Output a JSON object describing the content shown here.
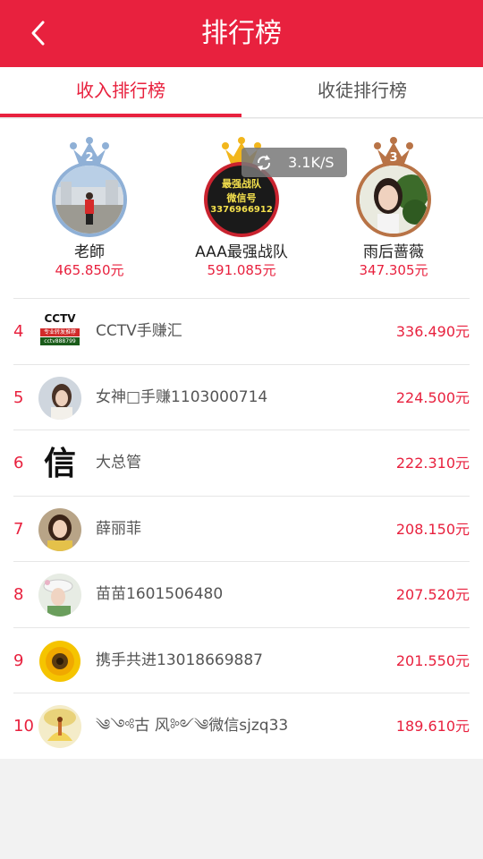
{
  "header": {
    "title": "排行榜",
    "back_icon": "chevron-left-icon"
  },
  "tabs": [
    {
      "label": "收入排行榜",
      "active": true
    },
    {
      "label": "收徒排行榜",
      "active": false
    }
  ],
  "speed_badge": {
    "icon": "refresh-icon",
    "text": "3.1K/S"
  },
  "podium": [
    {
      "rank": "2",
      "name": "老師",
      "amount": "465.850元",
      "crown_color": "#8fb0d6"
    },
    {
      "rank": "1",
      "name": "AAA最强战队",
      "amount": "591.085元",
      "crown_color": "#f2b61c",
      "avatar_text": [
        "最强战队",
        "微信号",
        "3376966912"
      ]
    },
    {
      "rank": "3",
      "name": "雨后蔷薇",
      "amount": "347.305元",
      "crown_color": "#b87346"
    }
  ],
  "ranking": [
    {
      "rank": "4",
      "name": "CCTV手赚汇",
      "amount": "336.490元",
      "avatar_text": [
        "CCTV",
        "专业转发推荐",
        "cctv888799"
      ]
    },
    {
      "rank": "5",
      "name": "女神□手赚1103000714",
      "amount": "224.500元"
    },
    {
      "rank": "6",
      "name": "大总管",
      "amount": "222.310元",
      "avatar_text": [
        "信"
      ]
    },
    {
      "rank": "7",
      "name": "薛丽菲",
      "amount": "208.150元"
    },
    {
      "rank": "8",
      "name": "苗苗1601506480",
      "amount": "207.520元"
    },
    {
      "rank": "9",
      "name": "携手共进13018669887",
      "amount": "201.550元"
    },
    {
      "rank": "10",
      "name": "༄༺古 风༻༄微信sjzq33",
      "amount": "189.610元"
    }
  ],
  "colors": {
    "accent": "#e8213e",
    "background": "#f2f2f2"
  }
}
